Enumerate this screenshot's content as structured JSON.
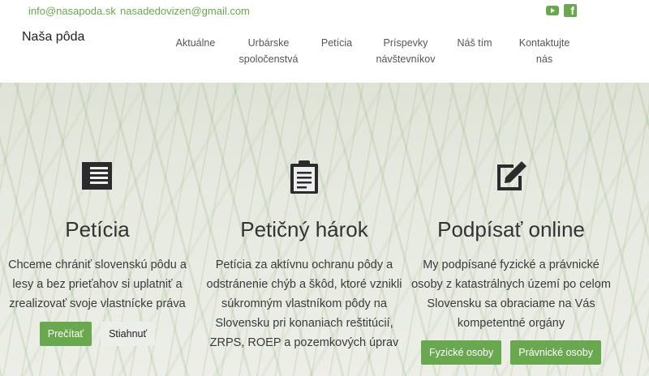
{
  "topbar": {
    "email1": "info@nasapoda.sk",
    "email2": "nasadedovizen@gmail.com",
    "social": [
      "youtube-icon",
      "facebook-icon"
    ]
  },
  "brand": "Naša pôda",
  "nav": [
    {
      "line1": "Aktuálne",
      "line2": ""
    },
    {
      "line1": "Urbárske",
      "line2": "spoločenstvá"
    },
    {
      "line1": "Petícia",
      "line2": ""
    },
    {
      "line1": "Príspevky",
      "line2": "návštevníkov"
    },
    {
      "line1": "Náš tím",
      "line2": ""
    },
    {
      "line1": "Kontaktujte",
      "line2": "nás"
    }
  ],
  "sections": [
    {
      "icon": "list-icon",
      "title": "Petícia",
      "text": "Chceme chrániť slovenskú pôdu a lesy a bez prieťahov si uplatniť a zrealizovať svoje vlastnícke práva",
      "btn1": "Prečítať",
      "btn2": "Stiahnuť"
    },
    {
      "icon": "clipboard-icon",
      "title": "Petičný hárok",
      "text": "Petícia za aktívnu ochranu pôdy a odstránenie chýb a škôd, ktoré vznikli súkromným vlastníkom pôdy na Slovensku pri konaniach reštitúcií, ZRPS, ROEP a pozemkových úprav"
    },
    {
      "icon": "edit-icon",
      "title": "Podpísať online",
      "text": "My podpísané fyzické a právnické osoby z katastrálnych území po celom Slovensku sa obraciame na Vás kompetentné orgány",
      "btn1": "Fyzické osoby",
      "btn2": "Právnické osoby"
    }
  ],
  "colors": {
    "accent": "#6aa84f"
  }
}
